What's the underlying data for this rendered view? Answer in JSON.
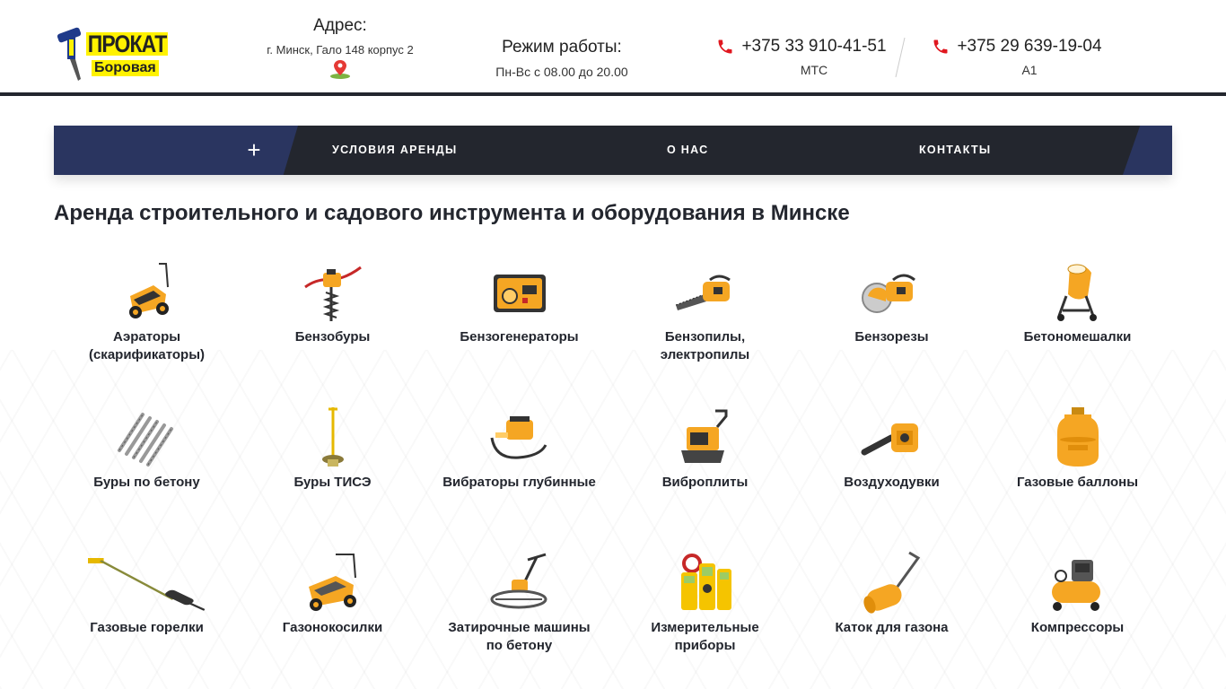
{
  "header": {
    "logo_line1": "ПРОКАТ",
    "logo_line2": "Боровая",
    "address_label": "Адрес:",
    "address_value": "г. Минск, Гало 148 корпус 2",
    "hours_label": "Режим работы:",
    "hours_value": "Пн-Вс с 08.00 до 20.00",
    "phones": [
      {
        "number": "+375 33 910-41-51",
        "operator": "МТС"
      },
      {
        "number": "+375 29 639-19-04",
        "operator": "А1"
      }
    ]
  },
  "nav": {
    "items": [
      "УСЛОВИЯ АРЕНДЫ",
      "О НАС",
      "КОНТАКТЫ"
    ]
  },
  "page_title": "Аренда строительного и садового инструмента и оборудования в Минске",
  "catalog": [
    {
      "label": "Аэраторы (скарификаторы)",
      "icon": "aerator-icon"
    },
    {
      "label": "Бензобуры",
      "icon": "auger-icon"
    },
    {
      "label": "Бензогенераторы",
      "icon": "generator-icon"
    },
    {
      "label": "Бензопилы, электропилы",
      "icon": "chainsaw-icon"
    },
    {
      "label": "Бензорезы",
      "icon": "cutoff-saw-icon"
    },
    {
      "label": "Бетономешалки",
      "icon": "concrete-mixer-icon"
    },
    {
      "label": "Буры по бетону",
      "icon": "drill-bits-icon"
    },
    {
      "label": "Буры ТИСЭ",
      "icon": "tise-drill-icon"
    },
    {
      "label": "Вибраторы глубинные",
      "icon": "vibrator-icon"
    },
    {
      "label": "Виброплиты",
      "icon": "plate-compactor-icon"
    },
    {
      "label": "Воздуходувки",
      "icon": "blower-icon"
    },
    {
      "label": "Газовые баллоны",
      "icon": "gas-cylinder-icon"
    },
    {
      "label": "Газовые горелки",
      "icon": "gas-torch-icon"
    },
    {
      "label": "Газонокосилки",
      "icon": "lawn-mower-icon"
    },
    {
      "label": "Затирочные машины по бетону",
      "icon": "power-trowel-icon"
    },
    {
      "label": "Измерительные приборы",
      "icon": "multimeter-icon"
    },
    {
      "label": "Каток для газона",
      "icon": "lawn-roller-icon"
    },
    {
      "label": "Компрессоры",
      "icon": "compressor-icon"
    }
  ],
  "colors": {
    "accent_yellow": "#f5a623",
    "nav_dark": "#23262e",
    "nav_blue": "#2a3560",
    "phone_red": "#e0171f"
  }
}
